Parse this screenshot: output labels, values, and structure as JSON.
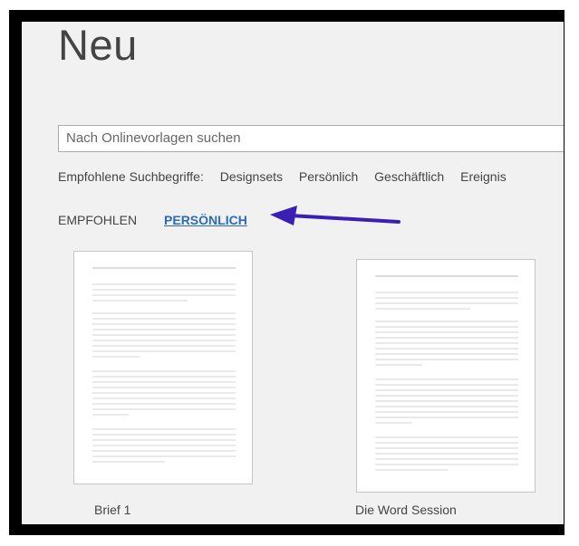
{
  "page": {
    "title": "Neu"
  },
  "search": {
    "placeholder": "Nach Onlinevorlagen suchen"
  },
  "suggestions": {
    "label": "Empfohlene Suchbegriffe:",
    "items": [
      "Designsets",
      "Persönlich",
      "Geschäftlich",
      "Ereignis"
    ]
  },
  "tabs": [
    {
      "label": "EMPFOHLEN",
      "active": false
    },
    {
      "label": "PERSÖNLICH",
      "active": true
    }
  ],
  "annotation": {
    "arrow_color": "#3b1fb5",
    "arrow_icon": "arrow-left-icon"
  },
  "templates": [
    {
      "name": "Brief 1"
    },
    {
      "name": "Die Word Session"
    }
  ],
  "colors": {
    "active_tab": "#2b6cb5",
    "background": "#f1f1f1"
  }
}
